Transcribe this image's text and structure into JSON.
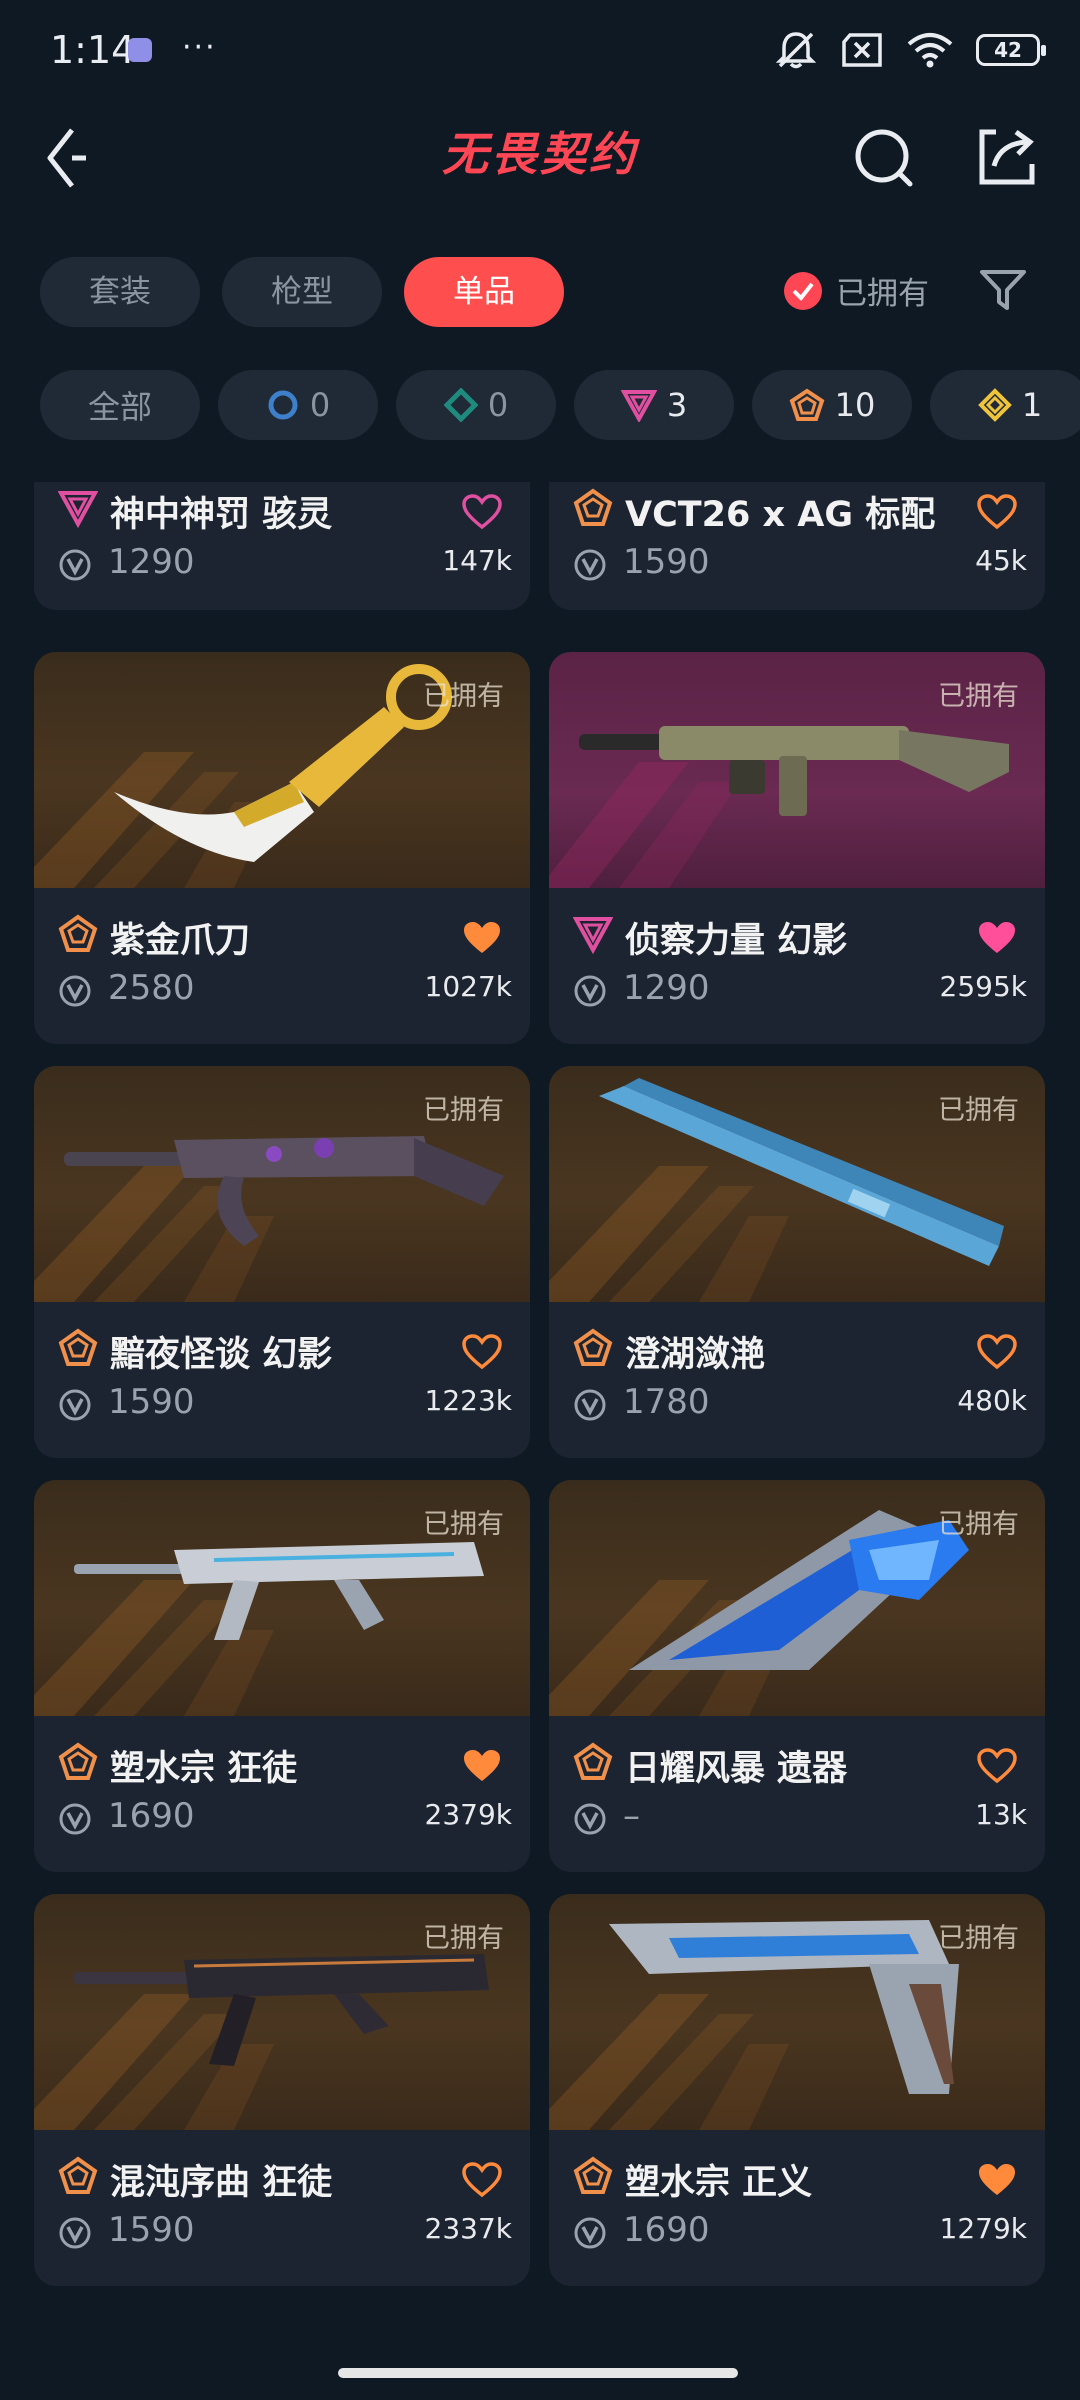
{
  "status": {
    "time": "1:14",
    "dots": "···",
    "battery": "42"
  },
  "header": {
    "title": "无畏契约"
  },
  "tabs": [
    {
      "label": "套装",
      "active": false
    },
    {
      "label": "枪型",
      "active": false
    },
    {
      "label": "单品",
      "active": true
    }
  ],
  "owned_filter": {
    "label": "已拥有",
    "checked": true
  },
  "chips": [
    {
      "label": "全部",
      "icon": ""
    },
    {
      "label": "0",
      "icon": "blue-ring-icon"
    },
    {
      "label": "0",
      "icon": "teal-diamond-icon"
    },
    {
      "label": "3",
      "icon": "pink-triangle-icon"
    },
    {
      "label": "10",
      "icon": "orange-pentagon-icon"
    },
    {
      "label": "1",
      "icon": "gold-diamond-icon"
    }
  ],
  "colors": {
    "accent": "#ff4655",
    "tab_active": "#ff4e4e",
    "heart_filled_orange": "#ff8a3c",
    "heart_filled_pink": "#ff4f9a",
    "rank_pink": "#e04fa0",
    "rank_orange": "#f0904a"
  },
  "items": [
    {
      "name": "神中神罚 骇灵",
      "rank": "pink",
      "price": "1290",
      "likes": "147k",
      "liked": false,
      "owned": false,
      "partial": true
    },
    {
      "name": "VCT26 x AG 标配",
      "rank": "orange",
      "price": "1590",
      "likes": "45k",
      "liked": false,
      "owned": false,
      "partial": true
    },
    {
      "name": "紫金爪刀",
      "rank": "orange",
      "price": "2580",
      "likes": "1027k",
      "liked": true,
      "owned": "已拥有",
      "bg": "brown",
      "weapon": "karambit"
    },
    {
      "name": "侦察力量 幻影",
      "rank": "pink",
      "price": "1290",
      "likes": "2595k",
      "liked": true,
      "owned": "已拥有",
      "bg": "purple",
      "weapon": "rifle-tan"
    },
    {
      "name": "黯夜怪谈 幻影",
      "rank": "orange",
      "price": "1590",
      "likes": "1223k",
      "liked": false,
      "owned": "已拥有",
      "bg": "brown",
      "weapon": "rifle-dark"
    },
    {
      "name": "澄湖潋滟",
      "rank": "orange",
      "price": "1780",
      "likes": "480k",
      "liked": false,
      "owned": "已拥有",
      "bg": "brown",
      "weapon": "fan"
    },
    {
      "name": "塑水宗 狂徒",
      "rank": "orange",
      "price": "1690",
      "likes": "2379k",
      "liked": true,
      "owned": "已拥有",
      "bg": "brown",
      "weapon": "rifle-silver"
    },
    {
      "name": "日耀风暴 遗器",
      "rank": "orange",
      "price": "–",
      "likes": "13k",
      "liked": false,
      "owned": "已拥有",
      "bg": "brown",
      "weapon": "blade-blue"
    },
    {
      "name": "混沌序曲 狂徒",
      "rank": "orange",
      "price": "1590",
      "likes": "2337k",
      "liked": false,
      "owned": "已拥有",
      "bg": "brown",
      "weapon": "rifle-black"
    },
    {
      "name": "塑水宗 正义",
      "rank": "orange",
      "price": "1690",
      "likes": "1279k",
      "liked": true,
      "owned": "已拥有",
      "bg": "brown",
      "weapon": "pistol-silver"
    }
  ]
}
